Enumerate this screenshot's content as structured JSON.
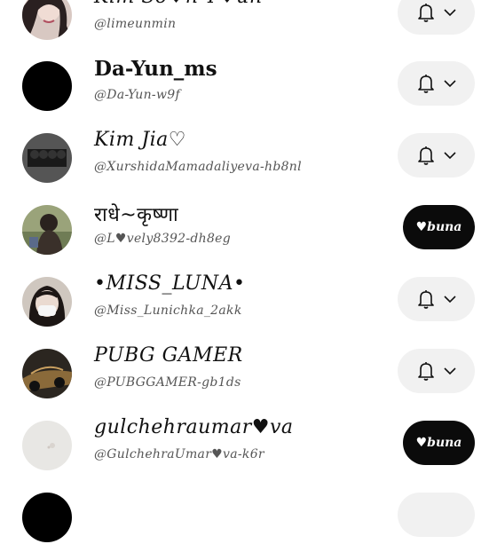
{
  "list": {
    "items": [
      {
        "name": "Kim So♥n Y♥un",
        "handle": "@limeunmin",
        "action": "bell"
      },
      {
        "name": "Da-Yun_ms",
        "handle": "@Da-Yun-w9f",
        "action": "bell"
      },
      {
        "name": "Kim Jia♡",
        "handle": "@XurshidaMamadaliyeva-hb8nl",
        "action": "bell"
      },
      {
        "name": "राधे~कृष्णा",
        "handle": "@L♥vely8392-dh8eg",
        "action": "follow",
        "button_label": "♥buna"
      },
      {
        "name": "•MISS_LUNA•",
        "handle": "@Miss_Lunichka_2akk",
        "action": "bell"
      },
      {
        "name": "PUBG GAMER",
        "handle": "@PUBGGAMER-gb1ds",
        "action": "bell"
      },
      {
        "name": "gulchehraumar♥va",
        "handle": "@GulchehraUmar♥va-k6r",
        "action": "follow",
        "button_label": "♥buna"
      }
    ]
  },
  "colors": {
    "background": "#ffffff",
    "bell_button_bg": "#f1f1f1",
    "follow_button_bg": "#0b0b0b",
    "handle_text": "#555555"
  },
  "icons": {
    "subscribed": "bell-icon",
    "menu": "chevron-down-icon"
  }
}
